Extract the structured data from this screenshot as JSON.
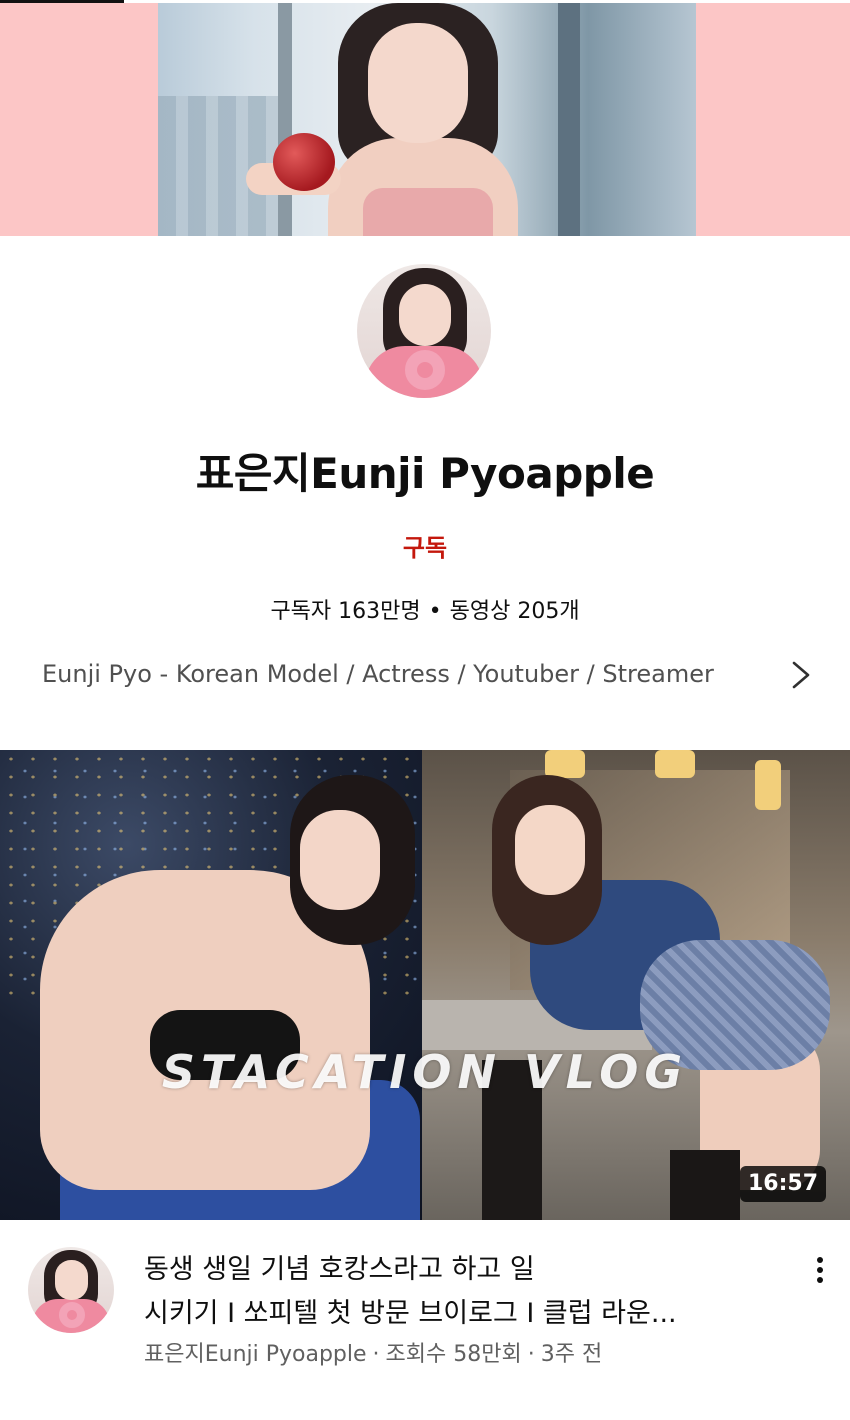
{
  "channel": {
    "name": "표은지Eunji Pyoapple",
    "subscribe_label": "구독",
    "subscribers": "구독자 163만명",
    "videos": "동영상 205개",
    "stats_separator": "•",
    "description": "Eunji Pyo - Korean Model / Actress / Youtuber / Streamer"
  },
  "video": {
    "overlay_text": "STACATION VLOG",
    "duration": "16:57",
    "title_line1": "동생 생일 기념 호캉스라고 하고 일",
    "title_line2": "시키기 I 쏘피텔 첫 방문 브이로그 I 클럽 라운...",
    "channel_name": "표은지Eunji Pyoapple",
    "views": "조회수 58만회",
    "age": "3주 전",
    "meta_separator": "·"
  },
  "icons": {
    "chevron": "chevron-right-icon",
    "more": "more-vert-icon"
  },
  "colors": {
    "banner_bg": "#fcc6c6",
    "subscribe": "#c4170c",
    "text_primary": "#0f0f0f",
    "text_secondary": "#606060"
  }
}
